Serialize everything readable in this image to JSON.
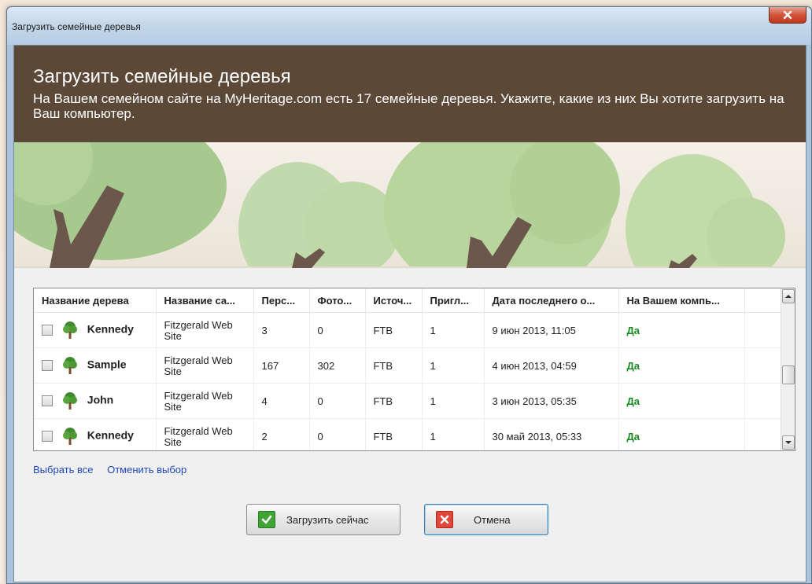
{
  "window": {
    "title": "Загрузить семейные деревья"
  },
  "header": {
    "title": "Загрузить семейные деревья",
    "description": "На Вашем семейном сайте на MyHeritage.com есть 17 семейные деревья. Укажите, какие из них Вы хотите загрузить на Ваш компьютер."
  },
  "table": {
    "columns": [
      "Название дерева",
      "Название са...",
      "Перс...",
      "Фото...",
      "Источ...",
      "Пригл...",
      "Дата последнего о...",
      "На Вашем компь..."
    ],
    "rows": [
      {
        "name": "Kennedy",
        "site": "Fitzgerald Web Site",
        "persons": "3",
        "photos": "0",
        "source": "FTB",
        "invited": "1",
        "date": "9 июн 2013, 11:05",
        "on_computer": "Да"
      },
      {
        "name": "Sample",
        "site": "Fitzgerald Web Site",
        "persons": "167",
        "photos": "302",
        "source": "FTB",
        "invited": "1",
        "date": "4 июн 2013, 04:59",
        "on_computer": "Да"
      },
      {
        "name": "John",
        "site": "Fitzgerald Web Site",
        "persons": "4",
        "photos": "0",
        "source": "FTB",
        "invited": "1",
        "date": "3 июн 2013, 05:35",
        "on_computer": "Да"
      },
      {
        "name": "Kennedy",
        "site": "Fitzgerald Web Site",
        "persons": "2",
        "photos": "0",
        "source": "FTB",
        "invited": "1",
        "date": "30 май 2013, 05:33",
        "on_computer": "Да"
      }
    ]
  },
  "links": {
    "select_all": "Выбрать все",
    "deselect": "Отменить выбор"
  },
  "buttons": {
    "download": "Загрузить сейчас",
    "cancel": "Отмена"
  },
  "colors": {
    "header_bg": "#5c4837",
    "on_computer": "#188a1d",
    "link": "#1f48b8"
  },
  "icons": {
    "close": "close-icon",
    "tree": "tree-icon",
    "check": "checkmark-icon",
    "cancel": "x-icon"
  }
}
